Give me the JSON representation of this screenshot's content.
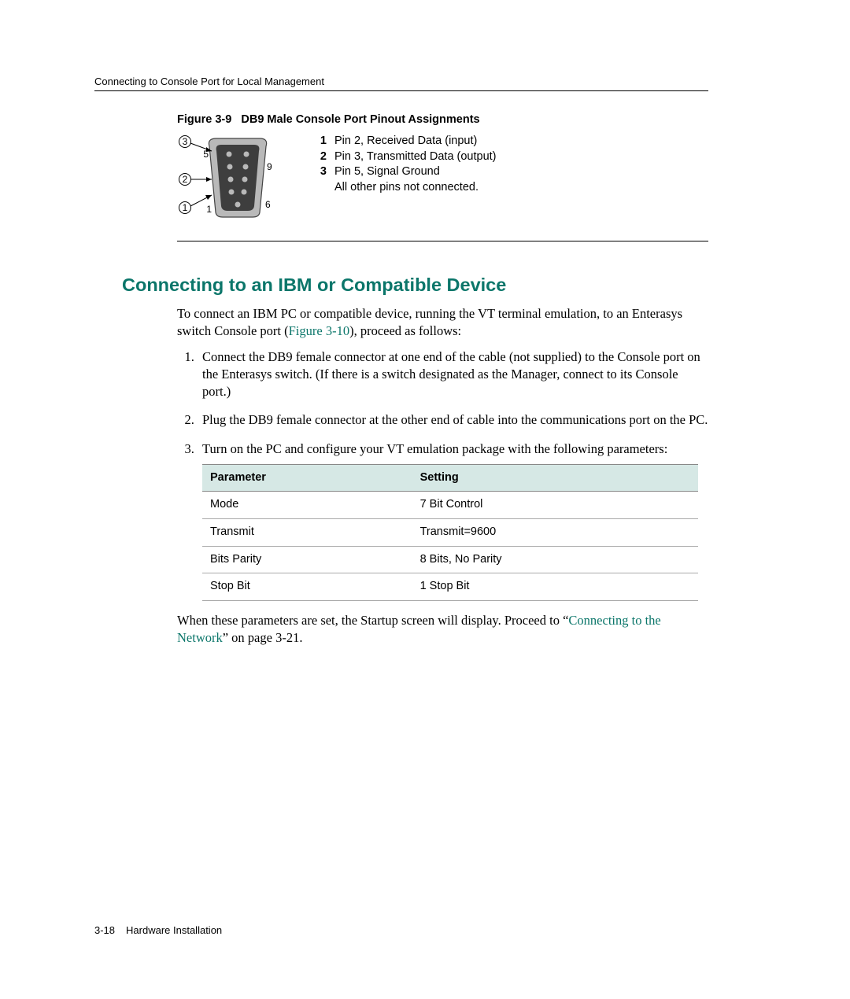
{
  "breadcrumb": "Connecting to Console Port for Local Management",
  "figure": {
    "label": "Figure 3-9",
    "title": "DB9 Male Console Port Pinout Assignments",
    "callouts": {
      "c1": "1",
      "c2": "2",
      "c3": "3"
    },
    "pin_labels": {
      "p1": "1",
      "p5": "5",
      "p6": "6",
      "p9": "9"
    },
    "legend": [
      {
        "num": "1",
        "text": "Pin 2, Received Data (input)"
      },
      {
        "num": "2",
        "text": "Pin 3, Transmitted Data (output)"
      },
      {
        "num": "3",
        "text": "Pin 5, Signal Ground"
      },
      {
        "num": "",
        "text": "All other pins not connected."
      }
    ]
  },
  "section": {
    "heading": "Connecting to an IBM or Compatible Device",
    "intro_pre": "To connect an IBM PC or compatible device, running the VT terminal emulation, to an Enterasys switch Console port (",
    "intro_link": "Figure 3-10",
    "intro_post": "), proceed as follows:",
    "steps": [
      "Connect the DB9 female connector at one end of the cable (not supplied) to the Console port on the Enterasys switch. (If there is a switch designated as the Manager, connect to its Console port.)",
      "Plug the DB9 female connector at the other end of cable into the communications port on the PC.",
      "Turn on the PC and configure your VT emulation package with the following parameters:"
    ],
    "table": {
      "headers": [
        "Parameter",
        "Setting"
      ],
      "rows": [
        [
          "Mode",
          "7 Bit Control"
        ],
        [
          "Transmit",
          "Transmit=9600"
        ],
        [
          "Bits Parity",
          "8 Bits, No Parity"
        ],
        [
          "Stop Bit",
          "1 Stop Bit"
        ]
      ]
    },
    "trailing_pre": "When these parameters are set, the Startup screen will display. Proceed to “",
    "trailing_link": "Connecting to the Network",
    "trailing_post": "” on page 3-21."
  },
  "footer": {
    "page": "3-18",
    "chapter": "Hardware Installation"
  }
}
